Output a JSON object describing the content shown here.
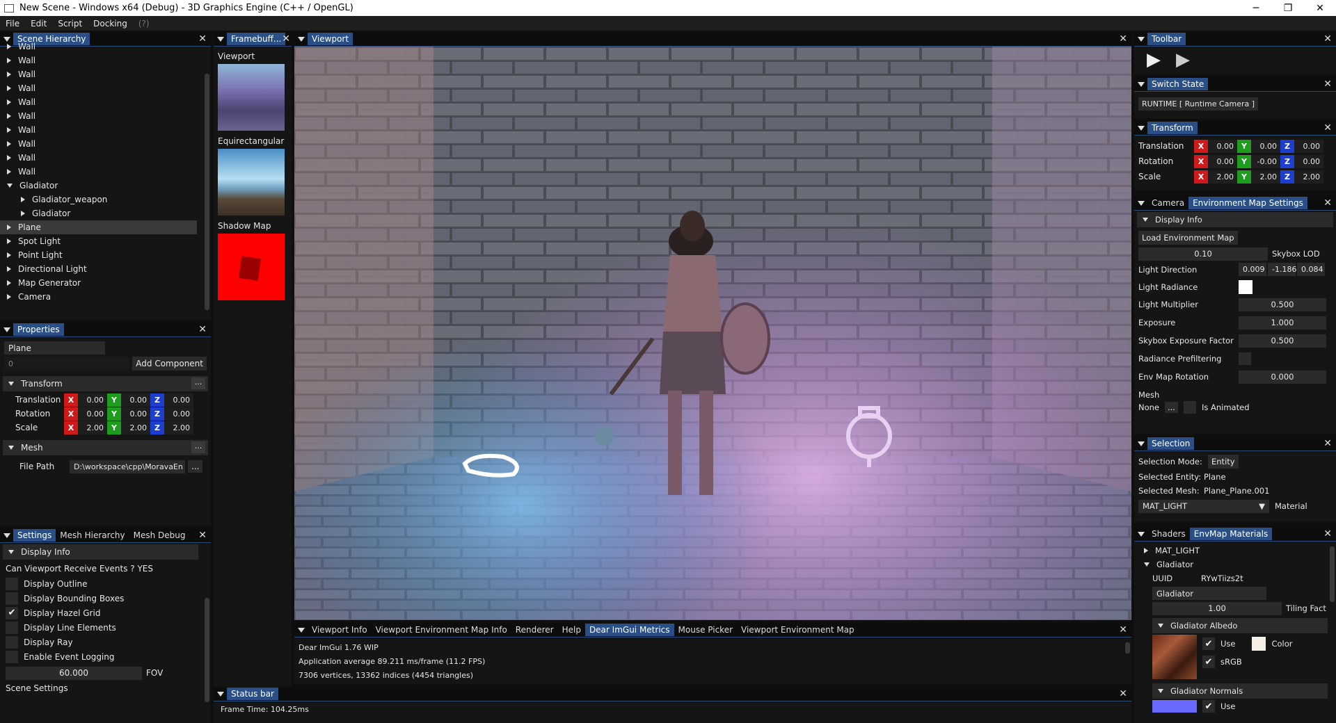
{
  "window": {
    "title": "New Scene - Windows x64 (Debug) - 3D Graphics Engine (C++ / OpenGL)",
    "min": "─",
    "max": "❐",
    "close": "✕"
  },
  "menu": [
    "File",
    "Edit",
    "Script",
    "Docking",
    "(?)"
  ],
  "hierarchy": {
    "tab": "Scene Hierarchy",
    "walls": [
      "Wall",
      "Wall",
      "Wall",
      "Wall",
      "Wall",
      "Wall",
      "Wall",
      "Wall",
      "Wall",
      "Wall"
    ],
    "gladiator": "Gladiator",
    "children": [
      "Gladiator_weapon",
      "Gladiator"
    ],
    "items": [
      "Plane",
      "Spot Light",
      "Point Light",
      "Directional Light",
      "Map Generator",
      "Camera"
    ]
  },
  "properties": {
    "tab": "Properties",
    "name": "Plane",
    "id": "0",
    "add": "Add Component",
    "transform": "Transform",
    "translation": "Translation",
    "rotation": "Rotation",
    "scale": "Scale",
    "t": [
      "0.00",
      "0.00",
      "0.00"
    ],
    "r": [
      "0.00",
      "0.00",
      "0.00"
    ],
    "s": [
      "2.00",
      "2.00",
      "2.00"
    ],
    "mesh": "Mesh",
    "filepath_label": "File Path",
    "filepath": "D:\\workspace\\cpp\\MoravaEn",
    "dots": "..."
  },
  "settings": {
    "tabs": [
      "Settings",
      "Mesh Hierarchy",
      "Mesh Debug"
    ],
    "display_info": "Display Info",
    "viewport_events": "Can Viewport Receive Events ? YES",
    "options": [
      {
        "label": "Display Outline",
        "checked": false
      },
      {
        "label": "Display Bounding Boxes",
        "checked": false
      },
      {
        "label": "Display Hazel Grid",
        "checked": true
      },
      {
        "label": "Display Line Elements",
        "checked": false
      },
      {
        "label": "Display Ray",
        "checked": false
      },
      {
        "label": "Enable Event Logging",
        "checked": false
      }
    ],
    "fov_value": "60.000",
    "fov_label": "FOV",
    "scene_settings": "Scene Settings"
  },
  "framebuffers": {
    "tab": "Framebuff...",
    "items": [
      "Viewport",
      "Equirectangular",
      "Shadow Map"
    ]
  },
  "viewport": {
    "tab": "Viewport"
  },
  "info": {
    "tabs": [
      "Viewport Info",
      "Viewport Environment Map Info",
      "Renderer",
      "Help",
      "Dear ImGui Metrics",
      "Mouse Picker",
      "Viewport Environment Map"
    ],
    "lines": [
      "Dear ImGui 1.76 WIP",
      "Application average 89.211 ms/frame (11.2 FPS)",
      "7306 vertices, 13362 indices (4454 triangles)"
    ]
  },
  "status": {
    "tab": "Status bar",
    "text": "Frame Time: 104.25ms"
  },
  "toolbar": {
    "tab": "Toolbar",
    "play": "▶",
    "step": "▶"
  },
  "switch_state": {
    "tab": "Switch State",
    "value": "RUNTIME [ Runtime Camera ]"
  },
  "transform2": {
    "tab": "Transform",
    "translation": "Translation",
    "rotation": "Rotation",
    "scale": "Scale",
    "t": [
      "0.00",
      "0.00",
      "0.00"
    ],
    "r": [
      "0.00",
      "-0.00",
      "0.00"
    ],
    "s": [
      "2.00",
      "2.00",
      "2.00"
    ]
  },
  "envmap": {
    "tabs": [
      "Camera",
      "Environment Map Settings"
    ],
    "display_info": "Display Info",
    "load": "Load Environment Map",
    "skybox_lod": "0.10",
    "skybox_lod_label": "Skybox LOD",
    "light_direction": "Light Direction",
    "light_dir": [
      "0.009",
      "-1.186",
      "0.084"
    ],
    "light_radiance": "Light Radiance",
    "light_multiplier": "Light Multiplier",
    "light_multiplier_value": "0.500",
    "exposure": "Exposure",
    "exposure_value": "1.000",
    "skybox_exposure": "Skybox Exposure Factor",
    "skybox_exposure_value": "0.500",
    "radiance_prefiltering": "Radiance Prefiltering",
    "env_rotation": "Env Map Rotation",
    "env_rotation_value": "0.000",
    "mesh": "Mesh",
    "mesh_value": "None",
    "dots": "...",
    "is_animated": "Is Animated"
  },
  "selection": {
    "tab": "Selection",
    "mode_label": "Selection Mode:",
    "mode": "Entity",
    "entity_label": "Selected Entity:",
    "entity": "Plane",
    "mesh_label": "Selected Mesh:",
    "mesh": "Plane_Plane.001",
    "material": "MAT_LIGHT",
    "material_label": "Material"
  },
  "materials": {
    "tabs": [
      "Shaders",
      "EnvMap Materials"
    ],
    "mat_light": "MAT_LIGHT",
    "gladiator": "Gladiator",
    "uuid_label": "UUID",
    "uuid": "RYwTiizs2t",
    "name": "Gladiator",
    "tiling": "1.00",
    "tiling_label": "Tiling Fact",
    "albedo": "Gladiator Albedo",
    "use": "Use",
    "color": "Color",
    "srgb": "sRGB",
    "normals": "Gladiator Normals",
    "use2": "Use"
  }
}
